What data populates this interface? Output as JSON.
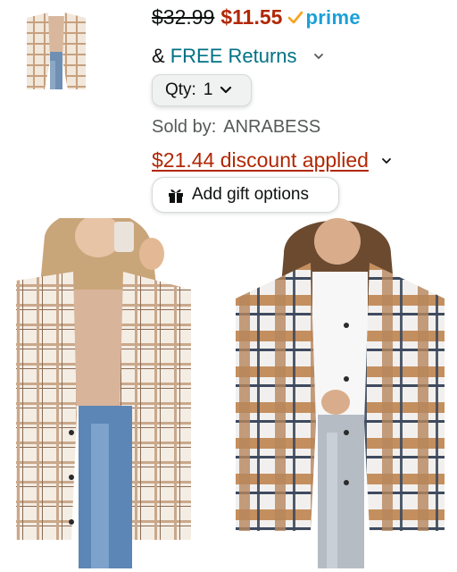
{
  "product": {
    "thumbnail_icon": "product-thumbnail-plaid-shirt",
    "list_price": "$32.99",
    "sale_price": "$11.55",
    "prime_label": "prime",
    "free_returns_prefix": "&",
    "free_returns_label": "FREE Returns",
    "quantity_label": "Qty:",
    "quantity_value": "1",
    "sold_by_label": "Sold by:",
    "seller_name": "ANRABESS",
    "discount_label": "$21.44 discount applied",
    "gift_button_label": "Add gift options"
  },
  "colors": {
    "price_red": "#b12704",
    "link_teal": "#007185",
    "prime_blue": "#1aa0d8",
    "prime_check_orange": "#f7a21c"
  },
  "images": {
    "left": "model-wearing-beige-plaid-shacket-photo",
    "right": "model-wearing-brown-plaid-shacket-photo"
  }
}
